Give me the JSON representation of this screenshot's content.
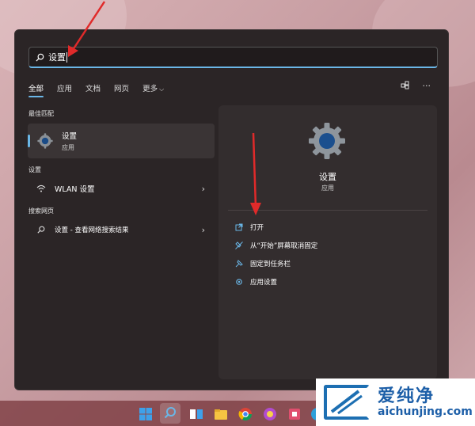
{
  "search": {
    "query": "设置",
    "icon": "search-icon"
  },
  "tabs": [
    {
      "label": "全部",
      "active": true
    },
    {
      "label": "应用",
      "active": false
    },
    {
      "label": "文档",
      "active": false
    },
    {
      "label": "网页",
      "active": false
    },
    {
      "label": "更多",
      "active": false
    }
  ],
  "tools": {
    "share_icon": "share-icon",
    "more": "···"
  },
  "sections": {
    "best_match": "最佳匹配",
    "settings": "设置",
    "web": "搜索网页"
  },
  "best_match": {
    "title": "设置",
    "subtitle": "应用"
  },
  "results": {
    "wlan": {
      "label": "WLAN 设置",
      "arrow": "›"
    },
    "web": {
      "label": "设置 - 查看网络搜索结果",
      "arrow": "›"
    }
  },
  "preview": {
    "name": "设置",
    "type": "应用",
    "actions": [
      {
        "label": "打开",
        "icon": "open-external-icon"
      },
      {
        "label": "从“开始”屏幕取消固定",
        "icon": "unpin-icon"
      },
      {
        "label": "固定到任务栏",
        "icon": "pin-icon"
      },
      {
        "label": "应用设置",
        "icon": "gear-icon"
      }
    ]
  },
  "watermark": {
    "brand": "爱纯净",
    "url": "aichunjing.com"
  },
  "colors": {
    "accent": "#6ab6e6",
    "annotation": "#e02a2a",
    "panel": "#2b2526"
  }
}
